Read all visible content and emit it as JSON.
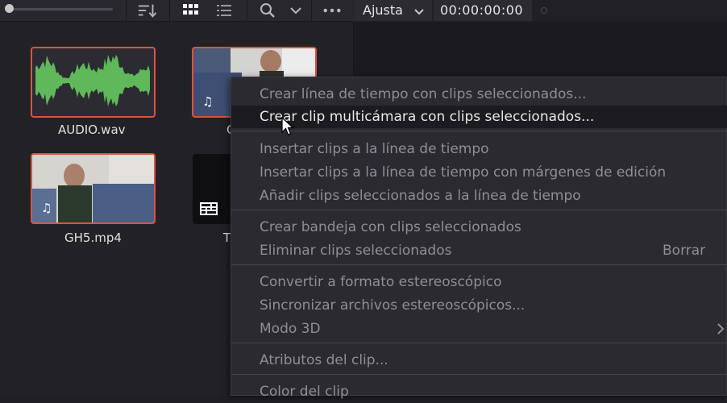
{
  "toolbar": {
    "icons": [
      "slider",
      "sort-icon",
      "grid-view-icon",
      "list-view-icon",
      "search-icon",
      "chevron-down-icon",
      "more-icon"
    ],
    "view_dropdown_label": "Ajusta",
    "timecode": "00:00:00:00"
  },
  "clips": [
    {
      "name": "AUDIO.wav",
      "kind": "audio",
      "selected": true
    },
    {
      "name": "G",
      "kind": "video",
      "selected": true
    },
    {
      "name": "GH5.mp4",
      "kind": "video",
      "selected": true
    },
    {
      "name": "T",
      "kind": "timeline",
      "selected": false
    }
  ],
  "menu": {
    "items": [
      {
        "label": "Crear línea de tiempo con clips seleccionados...",
        "enabled": false
      },
      {
        "label": "Crear clip multicámara con clips seleccionados...",
        "enabled": true,
        "hover": true
      },
      {
        "label": "Insertar clips a la línea de tiempo",
        "enabled": false
      },
      {
        "label": "Insertar clips a la línea de tiempo con márgenes de edición",
        "enabled": false
      },
      {
        "label": "Añadir clips seleccionados a la línea de tiempo",
        "enabled": false
      },
      {
        "label": "Crear bandeja con clips seleccionados",
        "enabled": false
      },
      {
        "label": "Eliminar clips seleccionados",
        "enabled": false,
        "shortcut": "Borrar"
      },
      {
        "label": "Convertir a formato estereoscópico",
        "enabled": false
      },
      {
        "label": "Sincronizar archivos estereoscópicos...",
        "enabled": false
      },
      {
        "label": "Modo 3D",
        "enabled": false,
        "submenu": true
      },
      {
        "label": "Atributos del clip...",
        "enabled": false
      },
      {
        "label": "Color del clip",
        "enabled": false,
        "submenu": true
      }
    ]
  },
  "colors": {
    "selection_border": "#e0513f",
    "menu_bg": "#2a2a30",
    "hover_bg": "#1b1b20",
    "waveform": "#5fb85a"
  }
}
